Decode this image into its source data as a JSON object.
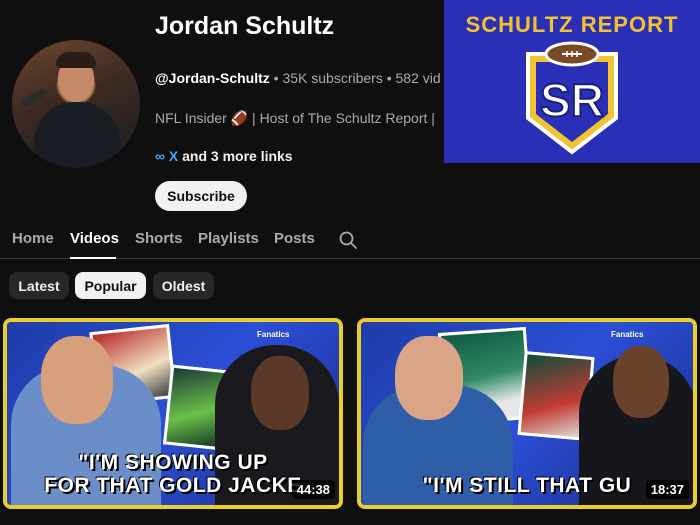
{
  "channel": {
    "name": "Jordan Schultz",
    "handle": "@Jordan-Schultz",
    "stats": " • 35K subscribers • 582 vid",
    "description": "NFL Insider 🏈 | Host of The Schultz Report |",
    "links_icon": "∞",
    "links_x": "X",
    "links_more": " and 3 more links",
    "subscribe_label": "Subscribe"
  },
  "banner": {
    "title": "SCHULTZ  REPORT",
    "logo_text": "SR",
    "accent": "#f2c230",
    "background": "#2a2fb8"
  },
  "tabs": [
    {
      "label": "Home",
      "active": false
    },
    {
      "label": "Videos",
      "active": true
    },
    {
      "label": "Shorts",
      "active": false
    },
    {
      "label": "Playlists",
      "active": false
    },
    {
      "label": "Posts",
      "active": false
    }
  ],
  "search_icon": "search-icon",
  "filters": [
    {
      "label": "Latest",
      "selected": false
    },
    {
      "label": "Popular",
      "selected": true
    },
    {
      "label": "Oldest",
      "selected": false
    }
  ],
  "videos": [
    {
      "caption_line1": "\"I'M SHOWING UP",
      "caption_line2": "FOR THAT GOLD JACKE",
      "duration": "44:38",
      "brand": "Fanatics"
    },
    {
      "caption_line1": "",
      "caption_line2": "\"I'M STILL THAT GU",
      "duration": "18:37",
      "brand": "Fanatics"
    }
  ],
  "colors": {
    "thumbnail_border": "#e9cf27",
    "link": "#3ea6ff"
  }
}
